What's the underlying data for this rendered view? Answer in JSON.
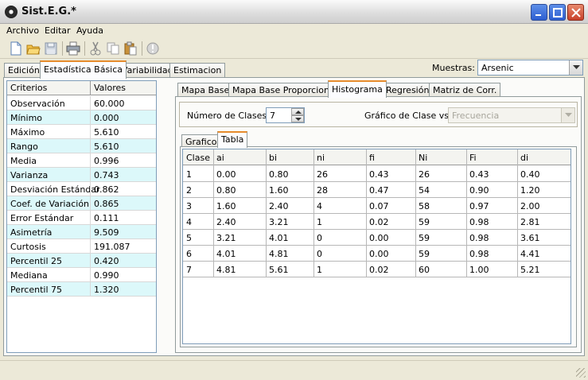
{
  "window": {
    "title": "Sist.E.G.*"
  },
  "menu": [
    "Archivo",
    "Editar",
    "Ayuda"
  ],
  "toolbar": {
    "icons": [
      "new-file-icon",
      "open-folder-icon",
      "save-icon",
      "print-icon",
      "cut-icon",
      "copy-icon",
      "paste-icon",
      "info-icon"
    ]
  },
  "main_tabs": [
    "Edición",
    "Estadística Básica",
    "Variabilidad",
    "Estimacion"
  ],
  "muestras": {
    "label": "Muestras:",
    "value": "Arsenic"
  },
  "stats": {
    "headers": [
      "Criterios",
      "Valores"
    ],
    "rows": [
      [
        "Observación",
        "60.000"
      ],
      [
        "Mínimo",
        "0.000"
      ],
      [
        "Máximo",
        "5.610"
      ],
      [
        "Rango",
        "5.610"
      ],
      [
        "Media",
        "0.996"
      ],
      [
        "Varianza",
        "0.743"
      ],
      [
        "Desviación Estándar",
        "0.862"
      ],
      [
        "Coef. de Variación",
        "0.865"
      ],
      [
        "Error Estándar",
        "0.111"
      ],
      [
        "Asimetría",
        "9.509"
      ],
      [
        "Curtosis",
        "191.087"
      ],
      [
        "Percentil 25",
        "0.420"
      ],
      [
        "Mediana",
        "0.990"
      ],
      [
        "Percentil 75",
        "1.320"
      ]
    ]
  },
  "sub_tabs": [
    "Mapa Base",
    "Mapa Base Proporcional",
    "Histograma",
    "Regresión",
    "Matriz de Corr."
  ],
  "controls": {
    "num_clases_label": "Número de Clases:",
    "num_clases_value": "7",
    "grafico_label": "Gráfico de Clase vs:",
    "grafico_value": "Frecuencia"
  },
  "inner_tabs": [
    "Grafico",
    "Tabla"
  ],
  "freq_table": {
    "headers": [
      "Clase",
      "ai",
      "bi",
      "ni",
      "fi",
      "Ni",
      "Fi",
      "di"
    ],
    "rows": [
      [
        "1",
        "0.00",
        "0.80",
        "26",
        "0.43",
        "26",
        "0.43",
        "0.40"
      ],
      [
        "2",
        "0.80",
        "1.60",
        "28",
        "0.47",
        "54",
        "0.90",
        "1.20"
      ],
      [
        "3",
        "1.60",
        "2.40",
        "4",
        "0.07",
        "58",
        "0.97",
        "2.00"
      ],
      [
        "4",
        "2.40",
        "3.21",
        "1",
        "0.02",
        "59",
        "0.98",
        "2.81"
      ],
      [
        "5",
        "3.21",
        "4.01",
        "0",
        "0.00",
        "59",
        "0.98",
        "3.61"
      ],
      [
        "6",
        "4.01",
        "4.81",
        "0",
        "0.00",
        "59",
        "0.98",
        "4.41"
      ],
      [
        "7",
        "4.81",
        "5.61",
        "1",
        "0.02",
        "60",
        "1.00",
        "5.21"
      ]
    ]
  },
  "colors": {
    "tab_accent": "#e68b2c",
    "row_highlight": "#dcf8fa",
    "title_close": "#c8412a"
  }
}
